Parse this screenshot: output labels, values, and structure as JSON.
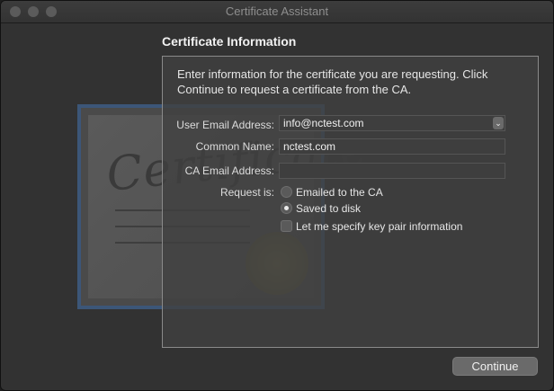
{
  "window": {
    "title": "Certificate Assistant"
  },
  "section": {
    "title": "Certificate Information"
  },
  "intro": "Enter information for the certificate you are requesting. Click Continue to request a certificate from the CA.",
  "form": {
    "user_email": {
      "label": "User Email Address:",
      "value": "info@nctest.com",
      "icon": "chevron-updown-icon"
    },
    "common_name": {
      "label": "Common Name:",
      "value": "nctest.com"
    },
    "ca_email": {
      "label": "CA Email Address:",
      "value": ""
    },
    "request": {
      "label": "Request is:",
      "options": [
        {
          "label": "Emailed to the CA",
          "selected": false
        },
        {
          "label": "Saved to disk",
          "selected": true
        }
      ]
    },
    "key_pair": {
      "label": "Let me specify key pair information",
      "checked": false
    }
  },
  "buttons": {
    "continue": "Continue"
  }
}
